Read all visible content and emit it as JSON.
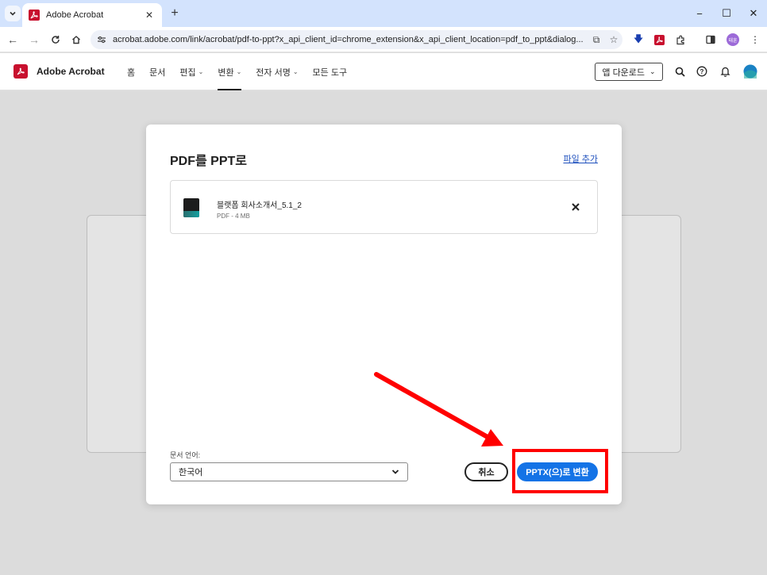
{
  "browser": {
    "tab": {
      "title": "Adobe Acrobat"
    },
    "url": "acrobat.adobe.com/link/acrobat/pdf-to-ppt?x_api_client_id=chrome_extension&x_api_client_location=pdf_to_ppt&dialog...",
    "profile_initials": "태훈"
  },
  "app": {
    "name": "Adobe Acrobat",
    "nav": [
      {
        "label": "홈"
      },
      {
        "label": "문서"
      },
      {
        "label": "편집"
      },
      {
        "label": "변환"
      },
      {
        "label": "전자 서명"
      },
      {
        "label": "모든 도구"
      }
    ],
    "download_label": "앱 다운로드"
  },
  "modal": {
    "title": "PDF를 PPT로",
    "add_file": "파일 추가",
    "file": {
      "name": "블랫폼 회사소개서_5.1_2",
      "meta": "PDF - 4 MB"
    },
    "language_label": "문서 언어:",
    "language_value": "한국어",
    "cancel_label": "취소",
    "convert_label": "PPTX(으)로 변환"
  },
  "colors": {
    "accent": "#1473e6",
    "annotation": "#ff0000",
    "brand": "#c8102e"
  }
}
